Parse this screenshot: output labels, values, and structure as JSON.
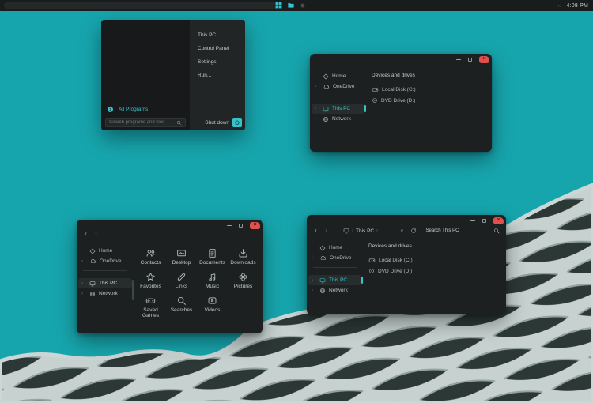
{
  "colors": {
    "accent": "#35c3ca",
    "desktop": "#17a5ad",
    "close_button": "#e0504d",
    "pattern_light": "#c6d1d0",
    "pattern_dark": "#2c3836"
  },
  "icons": {
    "close": "×",
    "back": "‹",
    "forward": "›",
    "chevron_right": "›",
    "breadcrumb": "›",
    "dropdown": "∨"
  },
  "taskbar": {
    "time": "4:08 PM"
  },
  "start_menu": {
    "items": [
      {
        "label": "This PC"
      },
      {
        "label": "Control Panel"
      },
      {
        "label": "Settings"
      },
      {
        "label": "Run..."
      }
    ],
    "all_programs_label": "All Programs",
    "search_placeholder": "Search programs and files",
    "shutdown_label": "Shut down"
  },
  "explorer_top_right": {
    "sidebar": {
      "items": [
        {
          "label": "Home"
        },
        {
          "label": "OneDrive"
        },
        {
          "label": "This PC",
          "selected": true
        },
        {
          "label": "Network"
        }
      ]
    },
    "content": {
      "section_title": "Devices and drives",
      "drives": [
        {
          "label": "Local Disk (C:)"
        },
        {
          "label": "DVD Drive (D:)"
        }
      ]
    }
  },
  "explorer_bottom_left": {
    "sidebar": {
      "items": [
        {
          "label": "Home"
        },
        {
          "label": "OneDrive"
        },
        {
          "label": "This PC",
          "selected": true
        },
        {
          "label": "Network"
        }
      ]
    },
    "folders": [
      {
        "label": "Contacts"
      },
      {
        "label": "Desktop"
      },
      {
        "label": "Documents"
      },
      {
        "label": "Downloads"
      },
      {
        "label": "Favorites"
      },
      {
        "label": "Links"
      },
      {
        "label": "Music"
      },
      {
        "label": "Pictures"
      },
      {
        "label": "Saved Games"
      },
      {
        "label": "Searches"
      },
      {
        "label": "Videos"
      }
    ]
  },
  "explorer_bottom_right": {
    "address": {
      "location": "This PC",
      "search_placeholder": "Search This PC"
    },
    "sidebar": {
      "items": [
        {
          "label": "Home"
        },
        {
          "label": "OneDrive"
        },
        {
          "label": "This PC",
          "selected": true
        },
        {
          "label": "Network"
        }
      ]
    },
    "content": {
      "section_title": "Devices and drives",
      "drives": [
        {
          "label": "Local Disk (C:)"
        },
        {
          "label": "DVD Drive (D:)"
        }
      ]
    }
  }
}
